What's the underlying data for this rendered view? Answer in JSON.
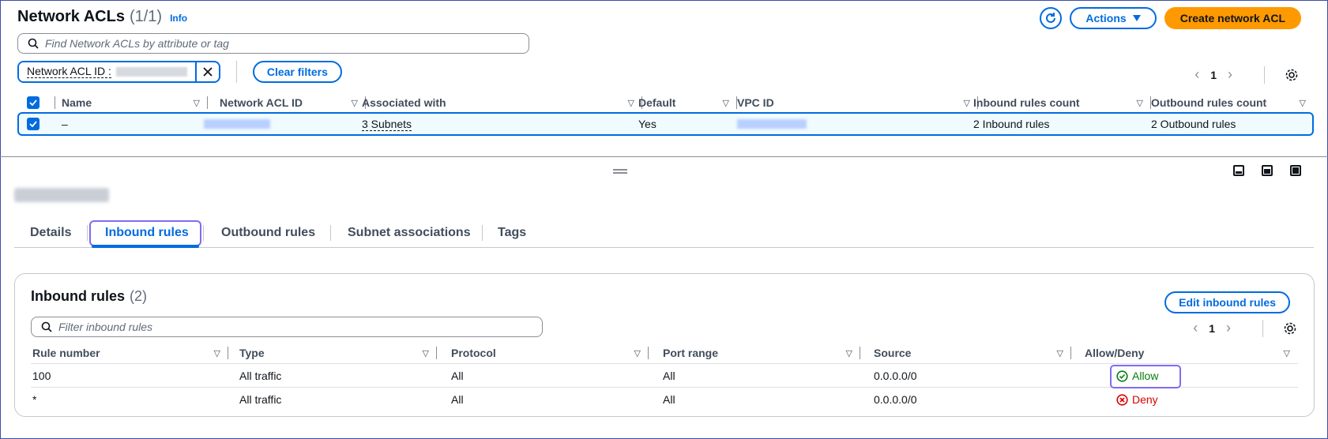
{
  "header": {
    "title": "Network ACLs",
    "count": "(1/1)",
    "info_label": "Info",
    "actions_label": "Actions",
    "create_label": "Create network ACL"
  },
  "search": {
    "placeholder": "Find Network ACLs by attribute or tag"
  },
  "filter": {
    "token_key": "Network ACL ID :",
    "clear_label": "Clear filters"
  },
  "top_pager": {
    "page": "1"
  },
  "acl_table": {
    "columns": [
      "Name",
      "Network ACL ID",
      "Associated with",
      "Default",
      "VPC ID",
      "Inbound rules count",
      "Outbound rules count"
    ],
    "rows": [
      {
        "name": "–",
        "associated": "3 Subnets",
        "default": "Yes",
        "inbound_count": "2 Inbound rules",
        "outbound_count": "2 Outbound rules"
      }
    ]
  },
  "tabs": [
    "Details",
    "Inbound rules",
    "Outbound rules",
    "Subnet associations",
    "Tags"
  ],
  "inbound": {
    "title": "Inbound rules",
    "count": "(2)",
    "edit_label": "Edit inbound rules",
    "filter_placeholder": "Filter inbound rules",
    "page": "1",
    "columns": [
      "Rule number",
      "Type",
      "Protocol",
      "Port range",
      "Source",
      "Allow/Deny"
    ],
    "rows": [
      {
        "rule": "100",
        "type": "All traffic",
        "protocol": "All",
        "port": "All",
        "source": "0.0.0.0/0",
        "action": "Allow"
      },
      {
        "rule": "*",
        "type": "All traffic",
        "protocol": "All",
        "port": "All",
        "source": "0.0.0.0/0",
        "action": "Deny"
      }
    ]
  },
  "colors": {
    "accent": "#006ce0",
    "primary": "#ff9900",
    "allow": "#037f0c",
    "deny": "#db0000",
    "focus": "#7f6cf0"
  }
}
